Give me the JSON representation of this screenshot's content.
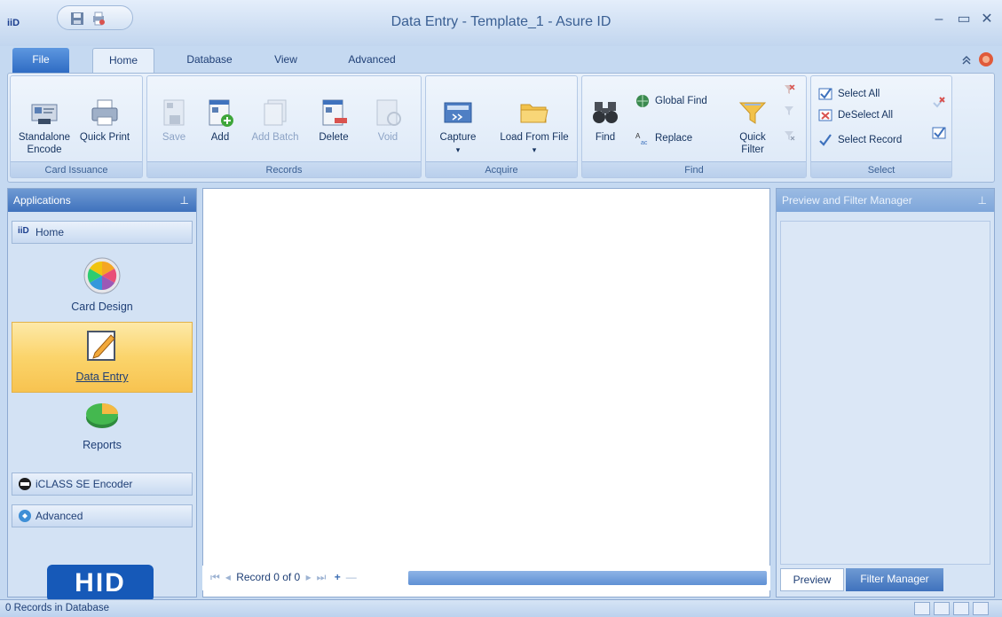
{
  "window": {
    "title": "Data Entry - Template_1 - Asure ID",
    "logo_text": "iiD"
  },
  "tabs": [
    "File",
    "Home",
    "Database",
    "View",
    "Advanced"
  ],
  "ribbon": {
    "card_issuance": {
      "label": "Card Issuance",
      "standalone_encode": "Standalone Encode",
      "quick_print": "Quick Print"
    },
    "records": {
      "label": "Records",
      "save": "Save",
      "add": "Add",
      "add_batch": "Add Batch",
      "delete": "Delete",
      "void": "Void"
    },
    "acquire": {
      "label": "Acquire",
      "capture": "Capture",
      "load_from_file": "Load From File"
    },
    "find": {
      "label": "Find",
      "find": "Find",
      "global_find": "Global Find",
      "replace": "Replace",
      "quick_filter": "Quick Filter"
    },
    "select": {
      "label": "Select",
      "select_all": "Select All",
      "deselect_all": "DeSelect All",
      "select_record": "Select Record"
    }
  },
  "left_pane": {
    "header": "Applications",
    "home_section": "Home",
    "items": [
      "Card Design",
      "Data Entry",
      "Reports"
    ],
    "encoder_section": "iCLASS SE Encoder",
    "advanced_section": "Advanced",
    "brand": "HID"
  },
  "record_nav": {
    "text": "Record 0 of 0"
  },
  "right_pane": {
    "header": "Preview and Filter Manager",
    "tab_preview": "Preview",
    "tab_filter": "Filter Manager"
  },
  "status": {
    "text": "0 Records in Database"
  },
  "colors": {
    "accent": "#3f72bd",
    "selected_nav": "#fbd46b",
    "brand": "#1659b8"
  }
}
